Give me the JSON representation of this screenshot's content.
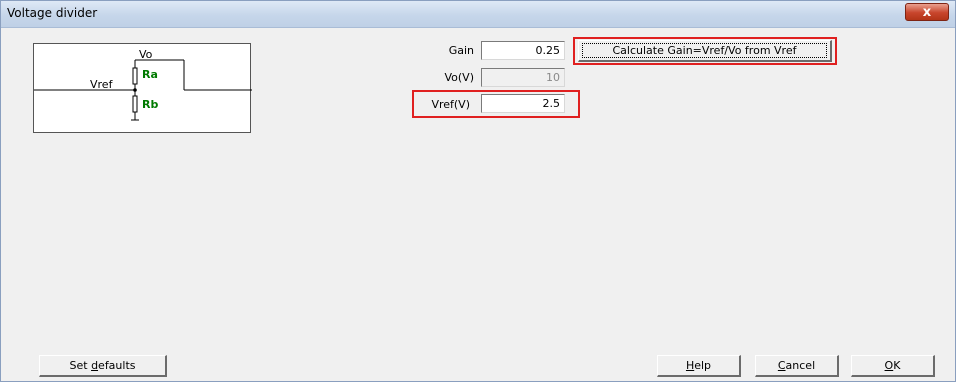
{
  "window": {
    "title": "Voltage divider",
    "close_label": "x"
  },
  "schematic": {
    "vo_label": "Vo",
    "vref_label": "Vref",
    "ra_label": "Ra",
    "rb_label": "Rb"
  },
  "fields": {
    "gain": {
      "label": "Gain",
      "value": "0.25"
    },
    "vo": {
      "label": "Vo(V)",
      "value": "10"
    },
    "vref": {
      "label": "Vref(V)",
      "value": "2.5"
    }
  },
  "buttons": {
    "calculate": "Calculate Gain=Vref/Vo from Vref",
    "set_defaults_pre": "Set ",
    "set_defaults_ul": "d",
    "set_defaults_post": "efaults",
    "help_ul": "H",
    "help_post": "elp",
    "cancel_ul": "C",
    "cancel_post": "ancel",
    "ok_ul": "O",
    "ok_post": "K"
  },
  "colors": {
    "highlight": "#e02020",
    "resistor_label": "#007a00"
  }
}
